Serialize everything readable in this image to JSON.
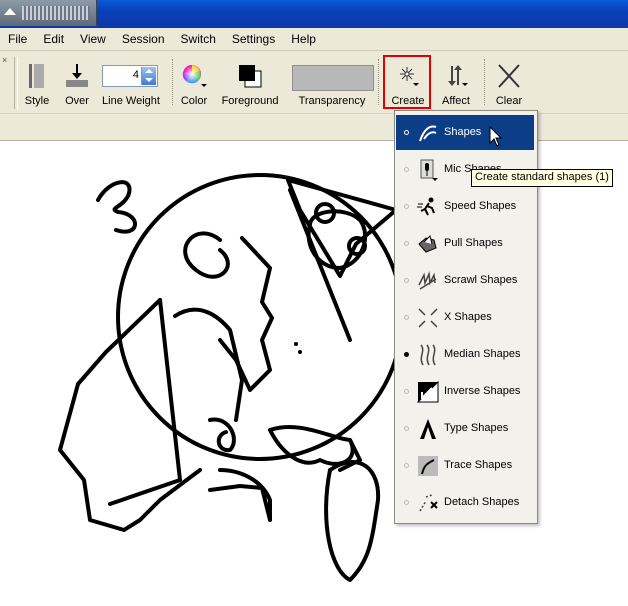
{
  "menu": [
    "File",
    "Edit",
    "View",
    "Session",
    "Switch",
    "Settings",
    "Help"
  ],
  "toolbar": {
    "close_glyph": "×",
    "style_label": "Style",
    "over_label": "Over",
    "line_weight_label": "Line Weight",
    "line_weight_value": "4",
    "color_label": "Color",
    "foreground_label": "Foreground",
    "transparency_label": "Transparency",
    "create_label": "Create",
    "affect_label": "Affect",
    "clear_label": "Clear"
  },
  "dropdown": {
    "items": [
      {
        "label": "Shapes",
        "icon": "shapes-icon",
        "selected": true,
        "active": false
      },
      {
        "label": "Mic Shapes",
        "icon": "mic-shapes-icon",
        "selected": false,
        "active": false
      },
      {
        "label": "Speed Shapes",
        "icon": "speed-shapes-icon",
        "selected": false,
        "active": false
      },
      {
        "label": "Pull Shapes",
        "icon": "pull-shapes-icon",
        "selected": false,
        "active": false
      },
      {
        "label": "Scrawl Shapes",
        "icon": "scrawl-shapes-icon",
        "selected": false,
        "active": false
      },
      {
        "label": "X Shapes",
        "icon": "x-shapes-icon",
        "selected": false,
        "active": false
      },
      {
        "label": "Median Shapes",
        "icon": "median-shapes-icon",
        "selected": false,
        "active": true
      },
      {
        "label": "Inverse Shapes",
        "icon": "inverse-shapes-icon",
        "selected": false,
        "active": false
      },
      {
        "label": "Type Shapes",
        "icon": "type-shapes-icon",
        "selected": false,
        "active": false
      },
      {
        "label": "Trace Shapes",
        "icon": "trace-shapes-icon",
        "selected": false,
        "active": false
      },
      {
        "label": "Detach Shapes",
        "icon": "detach-shapes-icon",
        "selected": false,
        "active": false
      }
    ]
  },
  "tooltip": "Create standard shapes (1)",
  "colors": {
    "titlebar": "#0a3fb8",
    "chrome": "#ece9d8",
    "selection": "#0b3e86",
    "highlight_box": "#e00000",
    "tooltip_bg": "#ffffe1"
  }
}
